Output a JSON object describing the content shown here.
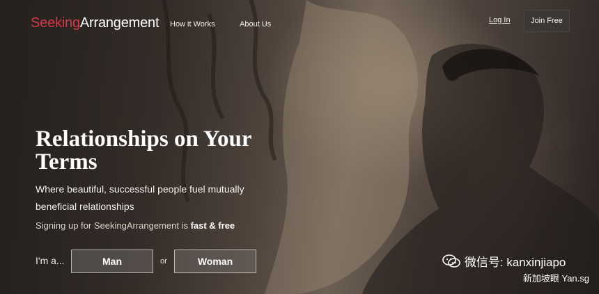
{
  "header": {
    "logo": {
      "part1": "Seeking",
      "part2": "Arrangement"
    },
    "nav": [
      "How it Works",
      "About Us"
    ],
    "login_label": "Log In",
    "join_label": "Join Free"
  },
  "hero": {
    "title": "Relationships on Your Terms",
    "subtitle": "Where beautiful, successful people fuel mutually beneficial relationships",
    "free_prefix": "Signing up for SeekingArrangement is ",
    "free_emphasis": "fast & free",
    "im_a": "I'm a...",
    "man_label": "Man",
    "or_label": "or",
    "woman_label": "Woman"
  },
  "watermark": {
    "line1": "微信号: kanxinjiapo",
    "line2": "新加坡眼 Yan.sg",
    "icon": "wechat-icon"
  },
  "colors": {
    "brand_red": "#d3394a",
    "button_bg": "#3c3836"
  }
}
